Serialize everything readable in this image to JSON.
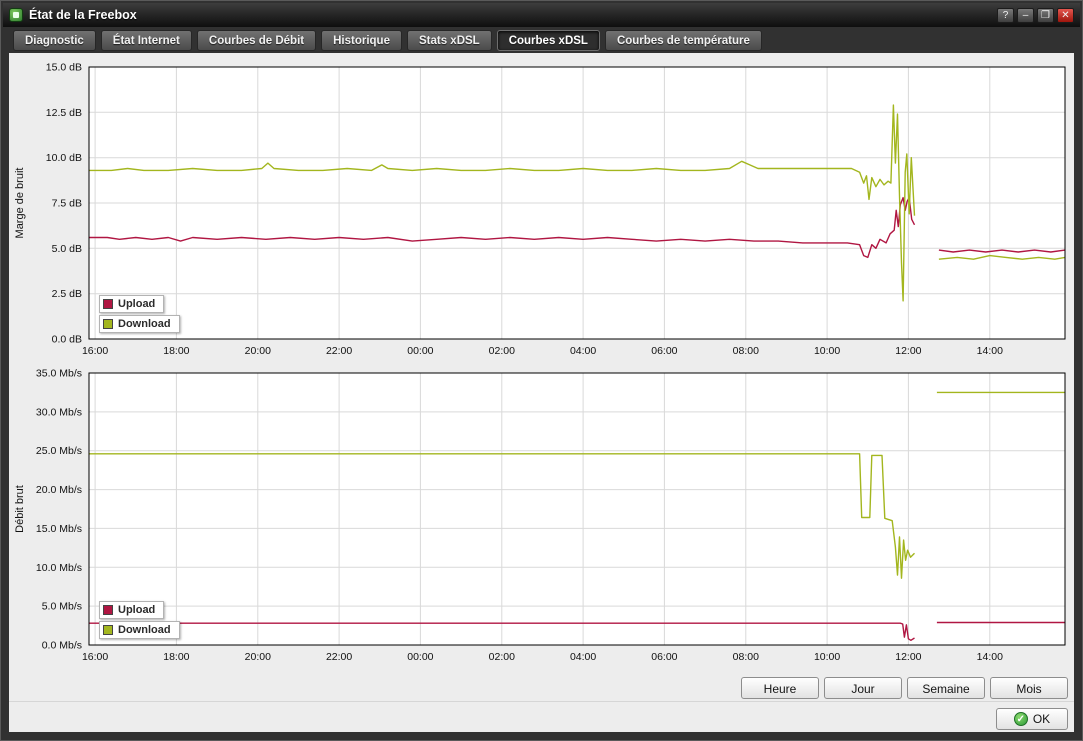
{
  "window": {
    "title": "État de la Freebox"
  },
  "controls": {
    "help": "?",
    "minimize": "–",
    "maximize": "❐",
    "close": "✕"
  },
  "icons": {
    "ok_check": "✓"
  },
  "tabs": [
    {
      "label": "Diagnostic",
      "active": false
    },
    {
      "label": "État Internet",
      "active": false
    },
    {
      "label": "Courbes de Débit",
      "active": false
    },
    {
      "label": "Historique",
      "active": false
    },
    {
      "label": "Stats xDSL",
      "active": false
    },
    {
      "label": "Courbes xDSL",
      "active": true
    },
    {
      "label": "Courbes de température",
      "active": false
    }
  ],
  "legend": {
    "upload": "Upload",
    "download": "Download"
  },
  "colors": {
    "upload": "#b01642",
    "download": "#a3b61e",
    "grid": "#d9d9d9",
    "axis": "#000000"
  },
  "range_buttons": [
    "Heure",
    "Jour",
    "Semaine",
    "Mois"
  ],
  "ok_label": "OK",
  "chart_data": [
    {
      "type": "line",
      "title": "",
      "xlabel": "",
      "ylabel": "Marge de bruit",
      "x_unit": "hours offset from 16:00 (24h window)",
      "xlim": [
        -0.15,
        23.85
      ],
      "ylim": [
        0,
        15
      ],
      "grid": true,
      "legend_position": "bottom-left",
      "xticks": [
        {
          "t": 0,
          "label": "16:00"
        },
        {
          "t": 2,
          "label": "18:00"
        },
        {
          "t": 4,
          "label": "20:00"
        },
        {
          "t": 6,
          "label": "22:00"
        },
        {
          "t": 8,
          "label": "00:00"
        },
        {
          "t": 10,
          "label": "02:00"
        },
        {
          "t": 12,
          "label": "04:00"
        },
        {
          "t": 14,
          "label": "06:00"
        },
        {
          "t": 16,
          "label": "08:00"
        },
        {
          "t": 18,
          "label": "10:00"
        },
        {
          "t": 20,
          "label": "12:00"
        },
        {
          "t": 22,
          "label": "14:00"
        }
      ],
      "yticks": [
        {
          "v": 15,
          "label": "15.0 dB"
        },
        {
          "v": 12.5,
          "label": "12.5 dB"
        },
        {
          "v": 10,
          "label": "10.0 dB"
        },
        {
          "v": 7.5,
          "label": "7.5 dB"
        },
        {
          "v": 5,
          "label": "5.0 dB"
        },
        {
          "v": 2.5,
          "label": "2.5 dB"
        },
        {
          "v": 0,
          "label": "0.0 dB"
        }
      ],
      "series": [
        {
          "name": "Upload",
          "color_key": "upload",
          "points": [
            [
              -0.15,
              5.6
            ],
            [
              0.3,
              5.6
            ],
            [
              0.6,
              5.5
            ],
            [
              1.0,
              5.6
            ],
            [
              1.4,
              5.5
            ],
            [
              1.8,
              5.6
            ],
            [
              2.1,
              5.4
            ],
            [
              2.4,
              5.6
            ],
            [
              3.0,
              5.5
            ],
            [
              3.6,
              5.6
            ],
            [
              4.2,
              5.5
            ],
            [
              4.8,
              5.6
            ],
            [
              5.4,
              5.5
            ],
            [
              6.0,
              5.6
            ],
            [
              6.6,
              5.5
            ],
            [
              7.2,
              5.6
            ],
            [
              7.8,
              5.4
            ],
            [
              8.4,
              5.5
            ],
            [
              9.0,
              5.6
            ],
            [
              9.6,
              5.5
            ],
            [
              10.2,
              5.6
            ],
            [
              10.8,
              5.5
            ],
            [
              11.4,
              5.6
            ],
            [
              12.0,
              5.5
            ],
            [
              12.6,
              5.6
            ],
            [
              13.2,
              5.5
            ],
            [
              13.8,
              5.4
            ],
            [
              14.4,
              5.5
            ],
            [
              15.0,
              5.4
            ],
            [
              15.6,
              5.5
            ],
            [
              16.2,
              5.4
            ],
            [
              16.8,
              5.4
            ],
            [
              17.4,
              5.3
            ],
            [
              18.0,
              5.3
            ],
            [
              18.5,
              5.3
            ],
            [
              18.8,
              5.2
            ],
            [
              18.9,
              4.6
            ],
            [
              19.0,
              4.5
            ],
            [
              19.1,
              5.2
            ],
            [
              19.2,
              5.0
            ],
            [
              19.3,
              5.5
            ],
            [
              19.45,
              5.3
            ],
            [
              19.55,
              5.8
            ],
            [
              19.65,
              6.0
            ],
            [
              19.7,
              7.1
            ],
            [
              19.75,
              6.2
            ],
            [
              19.8,
              7.4
            ],
            [
              19.87,
              7.8
            ],
            [
              19.92,
              7.1
            ],
            [
              19.97,
              7.6
            ],
            [
              20.02,
              7.8
            ],
            [
              20.08,
              6.6
            ],
            [
              20.15,
              6.3
            ],
            null,
            [
              20.75,
              4.9
            ],
            [
              21.1,
              4.8
            ],
            [
              21.5,
              4.9
            ],
            [
              21.9,
              4.8
            ],
            [
              22.3,
              4.9
            ],
            [
              22.7,
              4.8
            ],
            [
              23.1,
              4.9
            ],
            [
              23.5,
              4.8
            ],
            [
              23.85,
              4.9
            ]
          ]
        },
        {
          "name": "Download",
          "color_key": "download",
          "points": [
            [
              -0.15,
              9.3
            ],
            [
              0.4,
              9.3
            ],
            [
              0.8,
              9.4
            ],
            [
              1.2,
              9.3
            ],
            [
              1.8,
              9.3
            ],
            [
              2.4,
              9.4
            ],
            [
              3.0,
              9.3
            ],
            [
              3.6,
              9.3
            ],
            [
              4.1,
              9.4
            ],
            [
              4.25,
              9.7
            ],
            [
              4.4,
              9.4
            ],
            [
              5.0,
              9.3
            ],
            [
              5.6,
              9.3
            ],
            [
              6.2,
              9.4
            ],
            [
              6.8,
              9.3
            ],
            [
              7.05,
              9.6
            ],
            [
              7.2,
              9.4
            ],
            [
              7.8,
              9.3
            ],
            [
              8.4,
              9.4
            ],
            [
              9.0,
              9.3
            ],
            [
              9.6,
              9.3
            ],
            [
              10.2,
              9.4
            ],
            [
              10.8,
              9.3
            ],
            [
              11.4,
              9.3
            ],
            [
              12.0,
              9.4
            ],
            [
              12.6,
              9.3
            ],
            [
              13.2,
              9.3
            ],
            [
              13.8,
              9.4
            ],
            [
              14.4,
              9.3
            ],
            [
              15.0,
              9.3
            ],
            [
              15.6,
              9.4
            ],
            [
              15.9,
              9.8
            ],
            [
              16.1,
              9.6
            ],
            [
              16.3,
              9.4
            ],
            [
              16.9,
              9.4
            ],
            [
              17.5,
              9.4
            ],
            [
              18.1,
              9.4
            ],
            [
              18.6,
              9.4
            ],
            [
              18.8,
              9.2
            ],
            [
              18.9,
              8.6
            ],
            [
              18.97,
              9.0
            ],
            [
              19.03,
              7.7
            ],
            [
              19.1,
              8.9
            ],
            [
              19.2,
              8.4
            ],
            [
              19.3,
              8.8
            ],
            [
              19.4,
              8.5
            ],
            [
              19.5,
              8.7
            ],
            [
              19.57,
              8.6
            ],
            [
              19.63,
              12.9
            ],
            [
              19.68,
              9.7
            ],
            [
              19.73,
              12.4
            ],
            [
              19.78,
              7.9
            ],
            [
              19.83,
              4.2
            ],
            [
              19.87,
              2.1
            ],
            [
              19.92,
              9.2
            ],
            [
              19.96,
              10.2
            ],
            [
              20.02,
              6.9
            ],
            [
              20.07,
              10.0
            ],
            [
              20.15,
              6.8
            ],
            null,
            [
              20.75,
              4.4
            ],
            [
              21.2,
              4.5
            ],
            [
              21.6,
              4.4
            ],
            [
              22.0,
              4.6
            ],
            [
              22.4,
              4.5
            ],
            [
              22.8,
              4.4
            ],
            [
              23.2,
              4.5
            ],
            [
              23.6,
              4.4
            ],
            [
              23.85,
              4.5
            ]
          ]
        }
      ]
    },
    {
      "type": "line",
      "title": "",
      "xlabel": "",
      "ylabel": "Débit brut",
      "x_unit": "hours offset from 16:00 (24h window)",
      "xlim": [
        -0.15,
        23.85
      ],
      "ylim": [
        0,
        35
      ],
      "grid": true,
      "legend_position": "bottom-left",
      "xticks": [
        {
          "t": 0,
          "label": "16:00"
        },
        {
          "t": 2,
          "label": "18:00"
        },
        {
          "t": 4,
          "label": "20:00"
        },
        {
          "t": 6,
          "label": "22:00"
        },
        {
          "t": 8,
          "label": "00:00"
        },
        {
          "t": 10,
          "label": "02:00"
        },
        {
          "t": 12,
          "label": "04:00"
        },
        {
          "t": 14,
          "label": "06:00"
        },
        {
          "t": 16,
          "label": "08:00"
        },
        {
          "t": 18,
          "label": "10:00"
        },
        {
          "t": 20,
          "label": "12:00"
        },
        {
          "t": 22,
          "label": "14:00"
        }
      ],
      "yticks": [
        {
          "v": 35,
          "label": "35.0 Mb/s"
        },
        {
          "v": 30,
          "label": "30.0 Mb/s"
        },
        {
          "v": 25,
          "label": "25.0 Mb/s"
        },
        {
          "v": 20,
          "label": "20.0 Mb/s"
        },
        {
          "v": 15,
          "label": "15.0 Mb/s"
        },
        {
          "v": 10,
          "label": "10.0 Mb/s"
        },
        {
          "v": 5,
          "label": "5.0 Mb/s"
        },
        {
          "v": 0,
          "label": "0.0 Mb/s"
        }
      ],
      "series": [
        {
          "name": "Upload",
          "color_key": "upload",
          "points": [
            [
              -0.15,
              2.8
            ],
            [
              4,
              2.8
            ],
            [
              8,
              2.8
            ],
            [
              12,
              2.8
            ],
            [
              16,
              2.8
            ],
            [
              19.5,
              2.8
            ],
            [
              19.8,
              2.8
            ],
            [
              19.86,
              2.7
            ],
            [
              19.9,
              1.0
            ],
            [
              19.95,
              2.6
            ],
            [
              20.0,
              0.8
            ],
            [
              20.06,
              0.6
            ],
            [
              20.15,
              0.9
            ],
            null,
            [
              20.7,
              2.9
            ],
            [
              23.85,
              2.9
            ]
          ]
        },
        {
          "name": "Download",
          "color_key": "download",
          "points": [
            [
              -0.15,
              24.6
            ],
            [
              4,
              24.6
            ],
            [
              8,
              24.6
            ],
            [
              12,
              24.6
            ],
            [
              16,
              24.6
            ],
            [
              18.8,
              24.6
            ],
            [
              18.85,
              16.4
            ],
            [
              19.05,
              16.4
            ],
            [
              19.1,
              24.4
            ],
            [
              19.35,
              24.4
            ],
            [
              19.42,
              16.3
            ],
            [
              19.6,
              16.0
            ],
            [
              19.68,
              12.6
            ],
            [
              19.73,
              9.0
            ],
            [
              19.78,
              13.9
            ],
            [
              19.83,
              8.6
            ],
            [
              19.88,
              13.5
            ],
            [
              19.93,
              10.9
            ],
            [
              19.98,
              12.2
            ],
            [
              20.05,
              11.3
            ],
            [
              20.15,
              11.8
            ],
            null,
            [
              20.7,
              32.5
            ],
            [
              23.85,
              32.5
            ]
          ]
        }
      ]
    }
  ]
}
